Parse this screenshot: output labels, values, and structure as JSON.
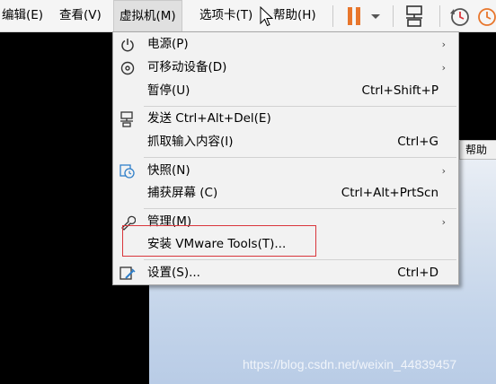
{
  "menubar": {
    "items": [
      {
        "label": "编辑(E)"
      },
      {
        "label": "查看(V)"
      },
      {
        "label": "虚拟机(M)"
      },
      {
        "label": "选项卡(T)"
      },
      {
        "label": "帮助(H)"
      }
    ],
    "toolbar_icons": [
      "pause-icon",
      "dropdown-arrow-icon",
      "network-icon",
      "snapshot-clock-icon",
      "revert-clock-icon"
    ],
    "accent_color": "#e8762c"
  },
  "vm_menu": {
    "items": [
      {
        "label": "电源(P)",
        "shortcut": "",
        "submenu": true,
        "icon": "power-icon"
      },
      {
        "label": "可移动设备(D)",
        "shortcut": "",
        "submenu": true,
        "icon": "removable-device-icon"
      },
      {
        "label": "暂停(U)",
        "shortcut": "Ctrl+Shift+P",
        "submenu": false,
        "icon": ""
      },
      {
        "label": "发送 Ctrl+Alt+Del(E)",
        "shortcut": "",
        "submenu": false,
        "icon": "send-keys-icon"
      },
      {
        "label": "抓取输入内容(I)",
        "shortcut": "Ctrl+G",
        "submenu": false,
        "icon": ""
      },
      {
        "label": "快照(N)",
        "shortcut": "",
        "submenu": true,
        "icon": "snapshot-icon"
      },
      {
        "label": "捕获屏幕 (C)",
        "shortcut": "Ctrl+Alt+PrtScn",
        "submenu": false,
        "icon": ""
      },
      {
        "label": "管理(M)",
        "shortcut": "",
        "submenu": true,
        "icon": "wrench-icon"
      },
      {
        "label": "安装 VMware Tools(T)...",
        "shortcut": "",
        "submenu": false,
        "icon": ""
      },
      {
        "label": "设置(S)...",
        "shortcut": "Ctrl+D",
        "submenu": false,
        "icon": "settings-icon"
      }
    ],
    "submenu_arrow": "›"
  },
  "guest": {
    "help_tag": "帮助"
  },
  "watermark": "https://blog.csdn.net/weixin_44839457",
  "highlight_color": "#d9363b"
}
